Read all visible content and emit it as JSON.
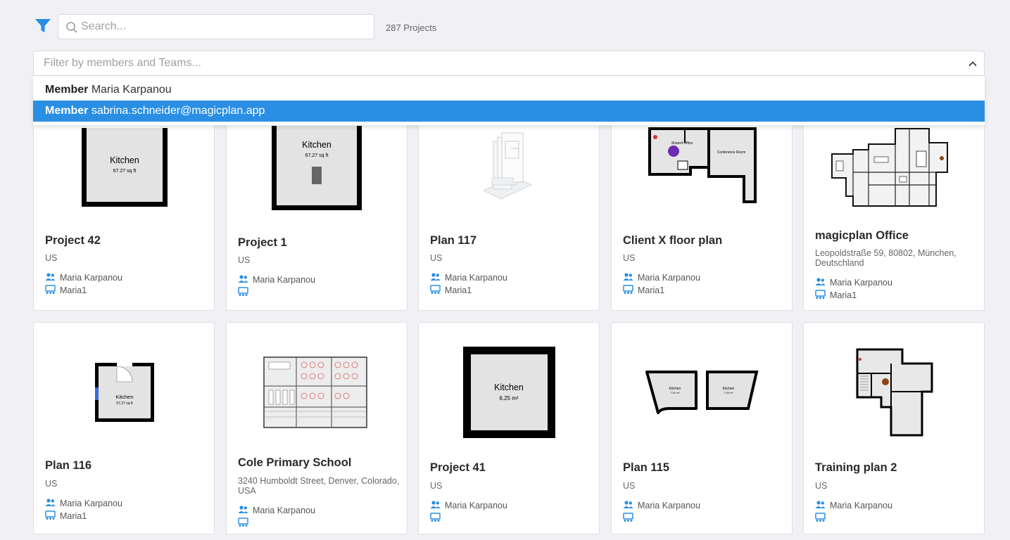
{
  "toolbar": {
    "search_placeholder": "Search...",
    "project_count": "287 Projects"
  },
  "member_filter": {
    "placeholder": "Filter by members and Teams...",
    "options": [
      {
        "kind": "Member",
        "value": "Maria Karpanou",
        "selected": false
      },
      {
        "kind": "Member",
        "value": "sabrina.schneider@magicplan.app",
        "selected": true
      }
    ]
  },
  "colors": {
    "accent": "#2a8fe4",
    "background": "#f1f1f5"
  },
  "projects": [
    {
      "title": "Project 42",
      "address": "US",
      "member": "Maria Karpanou",
      "team": "Maria1",
      "thumb": {
        "room": "Kitchen",
        "area": "67.27 sq ft"
      }
    },
    {
      "title": "Project 1",
      "address": "US",
      "member": "Maria Karpanou",
      "team": "",
      "thumb": {
        "room": "Kitchen",
        "area": "67.27 sq ft"
      }
    },
    {
      "title": "Plan 117",
      "address": "US",
      "member": "Maria Karpanou",
      "team": "Maria1"
    },
    {
      "title": "Client X floor plan",
      "address": "US",
      "member": "Maria Karpanou",
      "team": "Maria1",
      "thumb": {
        "room": "Shared Office",
        "room2": "Conference Room"
      }
    },
    {
      "title": "magicplan Office",
      "address": "Leopoldstraße 59, 80802, München, Deutschland",
      "member": "Maria Karpanou",
      "team": "Maria1"
    },
    {
      "title": "Plan 116",
      "address": "US",
      "member": "Maria Karpanou",
      "team": "Maria1",
      "thumb": {
        "room": "Kitchen",
        "area": "67.27 sq ft"
      }
    },
    {
      "title": "Cole Primary School",
      "address": "3240 Humboldt Street, Denver, Colorado, USA",
      "member": "Maria Karpanou",
      "team": ""
    },
    {
      "title": "Project 41",
      "address": "US",
      "member": "Maria Karpanou",
      "team": "",
      "thumb": {
        "room": "Kitchen",
        "area": "6.25 m²"
      }
    },
    {
      "title": "Plan 115",
      "address": "US",
      "member": "Maria Karpanou",
      "team": "",
      "thumb": {
        "room": "Kitchen",
        "area": "7.91 m²",
        "room2": "Kitchen",
        "area2": "7.09 m²"
      }
    },
    {
      "title": "Training plan 2",
      "address": "US",
      "member": "Maria Karpanou",
      "team": ""
    }
  ]
}
